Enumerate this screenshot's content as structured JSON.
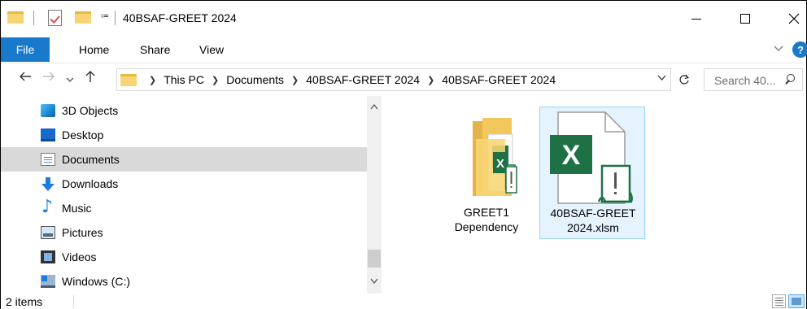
{
  "window": {
    "title": "40BSAF-GREET 2024",
    "qa_arrow": "⩴"
  },
  "ribbon": {
    "tabs": [
      "File",
      "Home",
      "Share",
      "View"
    ]
  },
  "address_bar": {
    "crumbs": [
      "This PC",
      "Documents",
      "40BSAF-GREET 2024",
      "40BSAF-GREET 2024"
    ],
    "search_placeholder": "Search 40..."
  },
  "sidebar": {
    "items": [
      {
        "label": "3D Objects",
        "icon": "3d-objects-icon",
        "selected": false
      },
      {
        "label": "Desktop",
        "icon": "desktop-icon",
        "selected": false
      },
      {
        "label": "Documents",
        "icon": "documents-icon",
        "selected": true
      },
      {
        "label": "Downloads",
        "icon": "downloads-icon",
        "selected": false
      },
      {
        "label": "Music",
        "icon": "music-icon",
        "selected": false
      },
      {
        "label": "Pictures",
        "icon": "pictures-icon",
        "selected": false
      },
      {
        "label": "Videos",
        "icon": "videos-icon",
        "selected": false
      },
      {
        "label": "Windows (C:)",
        "icon": "drive-icon",
        "selected": false
      }
    ]
  },
  "files": [
    {
      "name_line1": "GREET1",
      "name_line2": "Dependency",
      "type": "folder",
      "selected": false
    },
    {
      "name_line1": "40BSAF-GREET",
      "name_line2": "2024.xlsm",
      "type": "xlsm",
      "selected": true
    }
  ],
  "status": {
    "item_count": "2 items"
  },
  "colors": {
    "accent": "#1979ca",
    "excel_green": "#1e7145",
    "folder_yellow": "#f8d574",
    "selection": "#d9d9d9"
  }
}
